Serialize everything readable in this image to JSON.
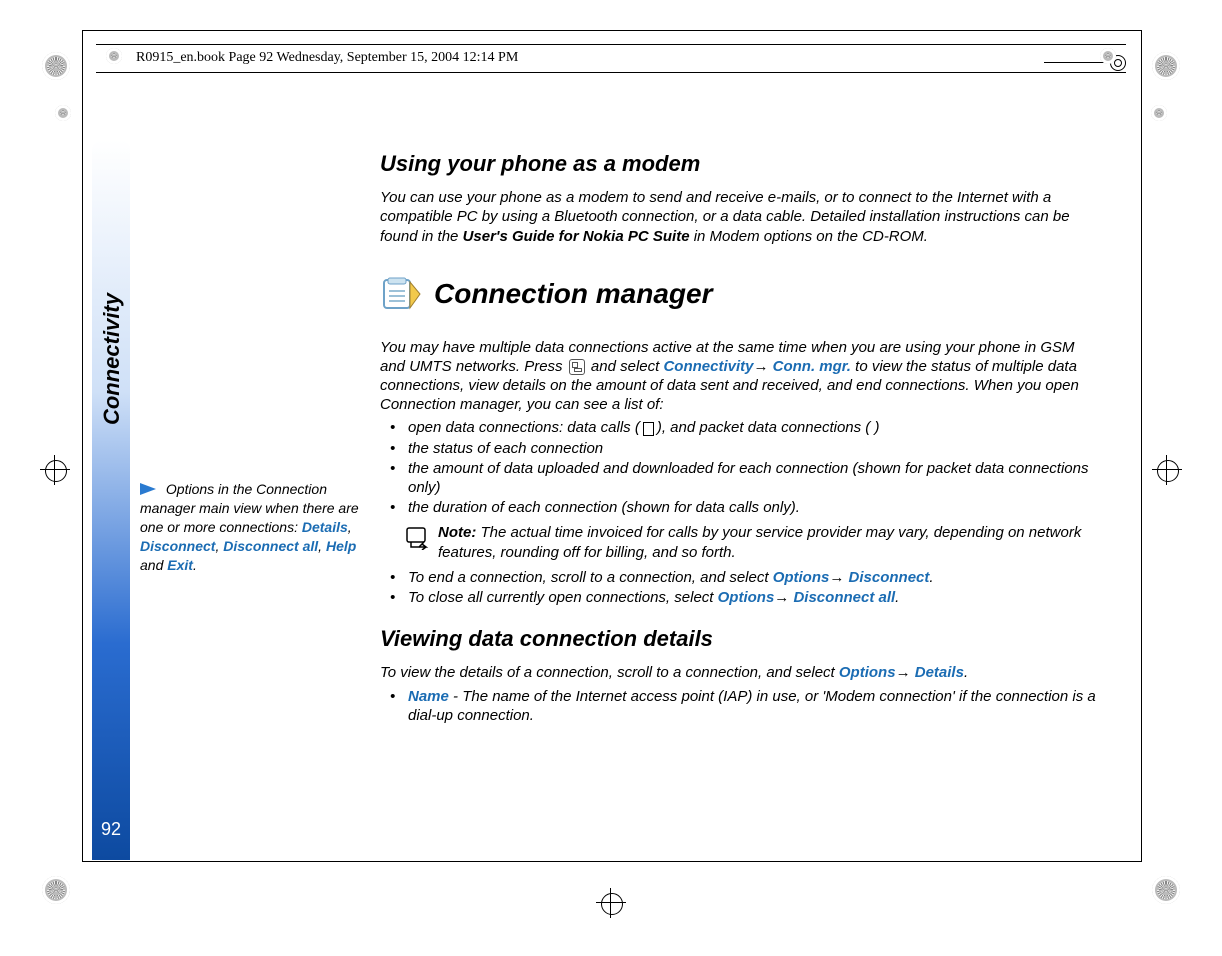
{
  "header": {
    "text": "R0915_en.book  Page 92  Wednesday, September 15, 2004  12:14 PM"
  },
  "tab": {
    "label": "Connectivity",
    "page": "92"
  },
  "section1": {
    "title": "Using your phone as a modem",
    "p1a": "You can use your phone as a modem to send and receive e-mails, or to connect to the Internet with a compatible PC by using a Bluetooth connection, or a data cable. Detailed installation instructions can be found in the ",
    "p1b_bold": "User's Guide for Nokia PC Suite",
    "p1c": " in Modem options on the CD-ROM."
  },
  "section2": {
    "title": "Connection manager",
    "p1a": "You may have multiple data connections active at the same time when you are using your phone in GSM and UMTS networks. Press ",
    "p1b": " and select ",
    "nav1": "Connectivity",
    "arrow": "→",
    "nav2": "Conn. mgr.",
    "p1c": " to view the status of multiple data connections, view details on the amount of data sent and received, and end connections. When you open Connection manager, you can see a list of:",
    "b1a": "open data connections: data calls (",
    "b1b": "), and packet data connections (      )",
    "b2": "the status of each connection",
    "b3": "the amount of data uploaded and downloaded for each connection (shown for packet data connections only)",
    "b4": "the duration of each connection (shown for data calls only).",
    "note_label": "Note:",
    "note_text": " The actual time invoiced for calls by your service provider may vary, depending on network features, rounding off for billing, and so forth.",
    "b5a": "To end a connection, scroll to a connection, and select ",
    "opt": "Options",
    "b5b": "Disconnect",
    "b5dot": ".",
    "b6a": "To close all currently open connections, select ",
    "b6b": "Disconnect all"
  },
  "section3": {
    "title": "Viewing data connection details",
    "p1a": "To view the details of a connection, scroll to a connection, and select ",
    "p1b": "Details",
    "p1dot": ".",
    "d1a": "Name",
    "d1b": " - The name of the Internet access point (IAP) in use, or 'Modem connection' if the connection is a dial-up connection."
  },
  "sidenote": {
    "lead": " Options in the Connection manager main view when there are one or more connections: ",
    "o1": "Details",
    "sep": ", ",
    "o2": "Disconnect",
    "o3": "Disconnect all",
    "o4": "Help",
    "and": " and ",
    "o5": "Exit",
    "dot": "."
  }
}
